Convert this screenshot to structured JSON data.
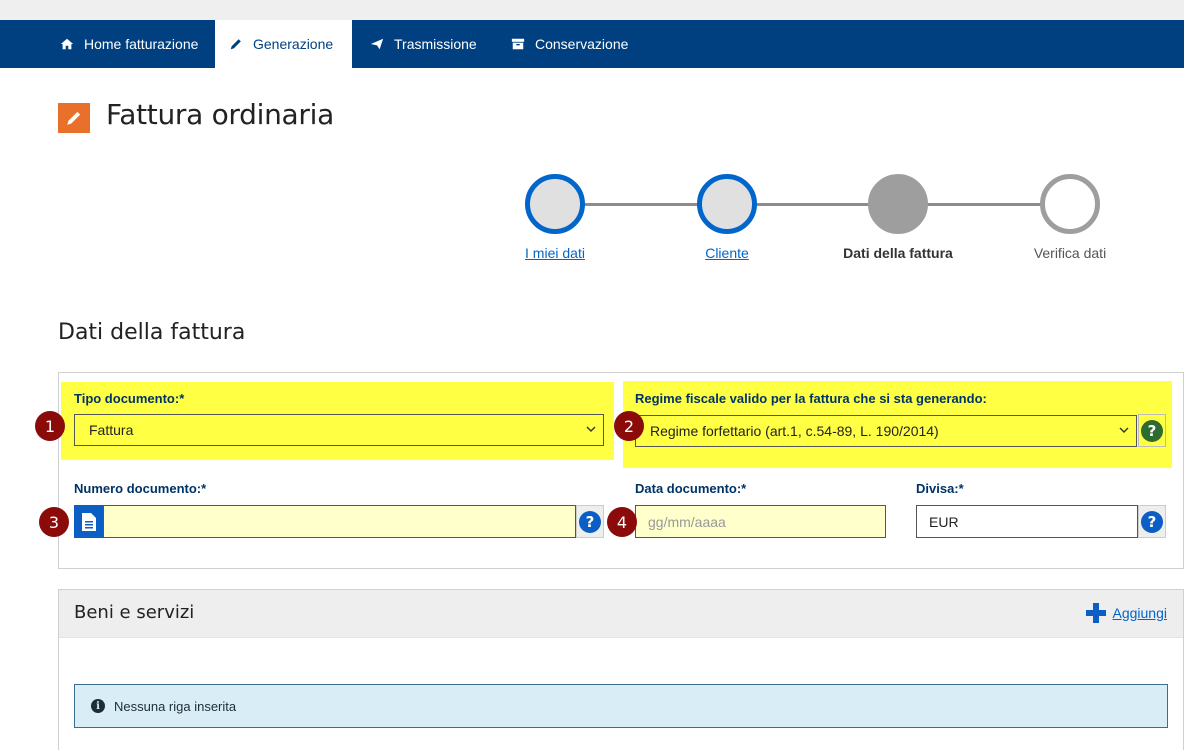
{
  "nav": {
    "tabs": [
      {
        "label": "Home fatturazione",
        "icon": "home-icon",
        "active": false
      },
      {
        "label": "Generazione",
        "icon": "pencil-icon",
        "active": true
      },
      {
        "label": "Trasmissione",
        "icon": "paper-plane-icon",
        "active": false
      },
      {
        "label": "Conservazione",
        "icon": "archive-icon",
        "active": false
      }
    ]
  },
  "page": {
    "title": "Fattura ordinaria",
    "icon": "edit-icon"
  },
  "stepper": {
    "steps": [
      {
        "label": "I miei dati",
        "state": "done"
      },
      {
        "label": "Cliente",
        "state": "done"
      },
      {
        "label": "Dati della fattura",
        "state": "current"
      },
      {
        "label": "Verifica dati",
        "state": "todo"
      }
    ]
  },
  "section": {
    "title": "Dati della fattura"
  },
  "form": {
    "tipo_documento": {
      "label": "Tipo documento:*",
      "value": "Fattura"
    },
    "regime_fiscale": {
      "label": "Regime fiscale valido per la fattura che si sta generando:",
      "value": "Regime forfettario (art.1, c.54-89, L. 190/2014)"
    },
    "numero_documento": {
      "label": "Numero documento:*",
      "value": ""
    },
    "data_documento": {
      "label": "Data documento:*",
      "placeholder": "gg/mm/aaaa"
    },
    "divisa": {
      "label": "Divisa:*",
      "value": "EUR"
    },
    "help_glyph": "?"
  },
  "badges": [
    "1",
    "2",
    "3",
    "4"
  ],
  "beni": {
    "title": "Beni e servizi",
    "add_label": "Aggiungi",
    "empty_message": "Nessuna riga inserita"
  },
  "colors": {
    "nav_bg": "#004080",
    "highlight": "#ffff44",
    "accent_orange": "#e8702a",
    "link_blue": "#0066cc",
    "badge": "#8b0a0a"
  }
}
